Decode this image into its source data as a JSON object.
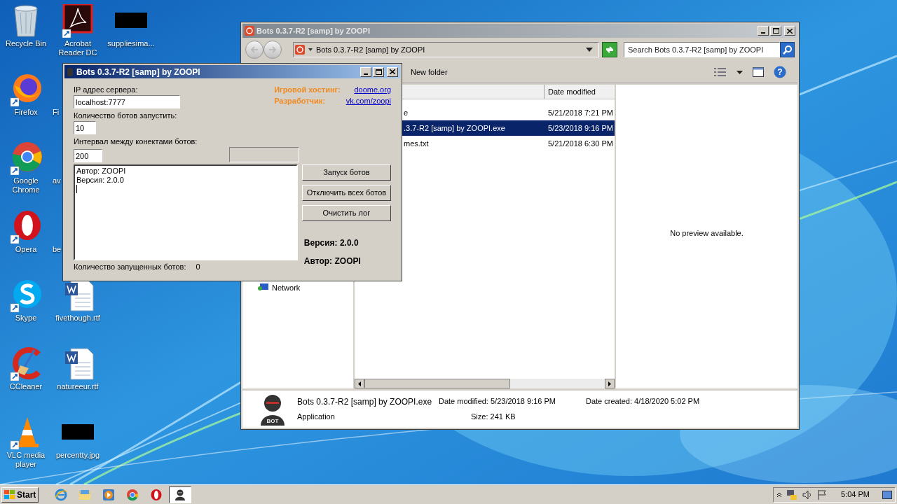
{
  "desktop_columns": [
    [
      {
        "kind": "recycle",
        "label": "Recycle Bin"
      },
      {
        "kind": "firefox",
        "label": "Firefox"
      },
      {
        "kind": "chrome",
        "label": "Google Chrome"
      },
      {
        "kind": "opera",
        "label": "Opera"
      },
      {
        "kind": "skype",
        "label": "Skype"
      },
      {
        "kind": "ccleaner",
        "label": "CCleaner"
      },
      {
        "kind": "vlc",
        "label": "VLC media player"
      }
    ],
    [
      {
        "kind": "acrobat",
        "label": "Acrobat Reader DC"
      },
      {
        "kind": "covered",
        "label": "Fi"
      },
      {
        "kind": "covered",
        "label": "av"
      },
      {
        "kind": "covered",
        "label": "be"
      },
      {
        "kind": "word",
        "label": "fivethough.rtf"
      },
      {
        "kind": "word",
        "label": "natureeur.rtf"
      },
      {
        "kind": "redacted",
        "label": "percentty.jpg"
      }
    ],
    [
      {
        "kind": "redacted",
        "label": "suppliesima..."
      }
    ]
  ],
  "explorer": {
    "title": "Bots 0.3.7-R2 [samp] by ZOOPI",
    "help_glyph": "?",
    "icon_text": "BOT",
    "address": "Bots 0.3.7-R2 [samp] by ZOOPI",
    "search_placeholder": "Search Bots 0.3.7-R2 [samp] by ZOOPI",
    "new_folder": "New folder",
    "nav_items": [
      {
        "label": "Network"
      }
    ],
    "column_2": "Date modified",
    "files": [
      {
        "name": "e",
        "date": "5/21/2018 7:21 PM",
        "selected": false
      },
      {
        "name": ".3.7-R2 [samp] by ZOOPI.exe",
        "date": "5/23/2018 9:16 PM",
        "selected": true
      },
      {
        "name": "mes.txt",
        "date": "5/21/2018 6:30 PM",
        "selected": false
      }
    ],
    "preview": "No preview available.",
    "details": {
      "name": "Bots 0.3.7-R2 [samp] by ZOOPI.exe",
      "type": "Application",
      "modified_label": "Date modified:",
      "modified": "5/23/2018 9:16 PM",
      "size_label": "Size:",
      "size": "241 KB",
      "created_label": "Date created:",
      "created": "4/18/2020 5:02 PM"
    }
  },
  "bots_window": {
    "title": "Bots 0.3.7-R2 [samp] by ZOOPI",
    "fields": [
      {
        "label": "IP адрес сервера:",
        "value": "localhost:7777"
      },
      {
        "label": "Количество ботов запустить:",
        "value": "10"
      },
      {
        "label": "Интервал между конектами ботов:",
        "value": "200"
      }
    ],
    "credits": [
      {
        "label": "Игровой хостинг:",
        "link": "doome.org"
      },
      {
        "label": "Разработчик:",
        "link": "vk.com/zoopi"
      }
    ],
    "log": [
      "Автор: ZOOPI",
      "Версия: 2.0.0"
    ],
    "buttons": [
      "Запуск ботов",
      "Отключить всех ботов",
      "Очистить лог"
    ],
    "info": [
      {
        "label": "Версия:",
        "value": "2.0.0"
      },
      {
        "label": "Автор:",
        "value": "ZOOPI"
      }
    ],
    "status": {
      "label": "Количество запущенных ботов:",
      "value": "0"
    }
  },
  "taskbar": {
    "start": "Start",
    "apps": [
      {
        "kind": "ie",
        "selected": false
      },
      {
        "kind": "folder",
        "selected": false
      },
      {
        "kind": "media",
        "selected": false
      },
      {
        "kind": "chrome",
        "selected": false
      },
      {
        "kind": "opera",
        "selected": false
      },
      {
        "kind": "bot",
        "selected": true
      }
    ],
    "clock": "5:04 PM"
  }
}
